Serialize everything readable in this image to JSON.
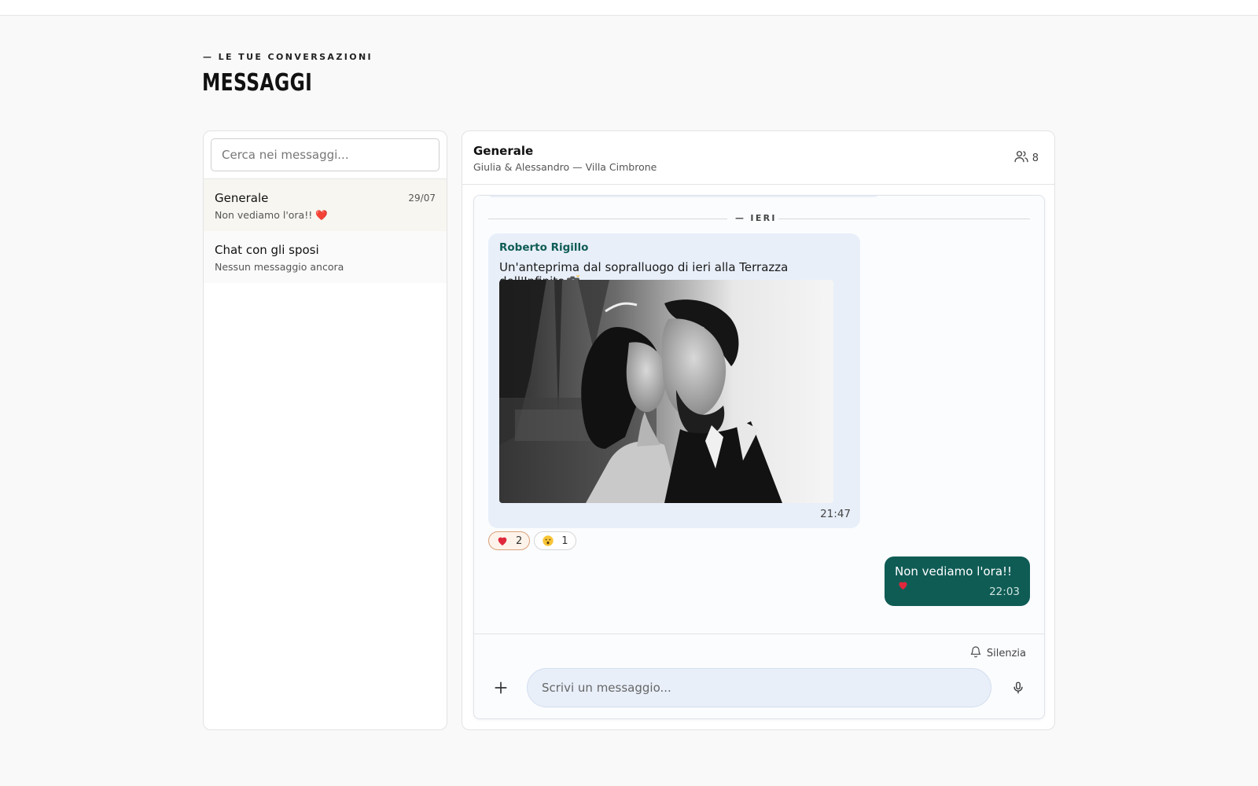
{
  "header": {
    "eyebrow": "— LE TUE CONVERSAZIONI",
    "title": "MESSAGGI"
  },
  "sidebar": {
    "search_placeholder": "Cerca nei messaggi...",
    "conversations": [
      {
        "name": "Generale",
        "preview": "Non vediamo l'ora!! ❤️",
        "date": "29/07",
        "active": true
      },
      {
        "name": "Chat con gli sposi",
        "preview": "Nessun messaggio ancora",
        "date": "",
        "active": false
      }
    ]
  },
  "chat": {
    "title": "Generale",
    "subtitle": "Giulia & Alessandro — Villa Cimbrone",
    "members_count": "8",
    "members_icon": "users-icon",
    "date_separator": "— IERI",
    "messages": [
      {
        "sender": "Roberto Rigillo",
        "text": "Un'anteprima dal sopralluogo di ieri alla Terrazza dell'Infinito",
        "text_emoji": "camera-flash-emoji",
        "image": "black-and-white wedding couple photo",
        "time": "21:47",
        "reactions": [
          {
            "emoji": "heart-emoji",
            "count": "2",
            "mine": true
          },
          {
            "emoji": "surprised-face-emoji",
            "count": "1",
            "mine": false
          }
        ]
      },
      {
        "sender": "me",
        "text": "Non vediamo l'ora!!",
        "text_emoji": "heart-emoji",
        "time": "22:03"
      }
    ]
  },
  "composer": {
    "mute_label": "Silenzia",
    "mute_icon": "bell-icon",
    "placeholder": "Scrivi un messaggio...",
    "attach_icon": "plus-icon",
    "mic_icon": "microphone-icon"
  },
  "colors": {
    "accent": "#0f5c55",
    "incoming_bubble": "#e8eff9",
    "active_item": "#f7f6f1",
    "background": "#f9f9f9"
  }
}
